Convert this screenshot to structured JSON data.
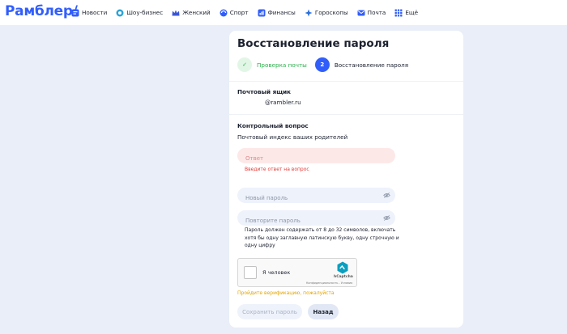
{
  "header": {
    "logo": "Рамблер/",
    "nav": [
      {
        "label": "Новости",
        "icon": "news-icon",
        "color": "#315efb"
      },
      {
        "label": "Шоу-бизнес",
        "icon": "showbiz-icon",
        "color": "#2aa3d8"
      },
      {
        "label": "Женский",
        "icon": "crown-icon",
        "color": "#3a55d9"
      },
      {
        "label": "Спорт",
        "icon": "sport-icon",
        "color": "#315efb"
      },
      {
        "label": "Финансы",
        "icon": "finance-icon",
        "color": "#315efb"
      },
      {
        "label": "Гороскопы",
        "icon": "horoscope-icon",
        "color": "#2a6fe0"
      },
      {
        "label": "Почта",
        "icon": "mail-icon",
        "color": "#315efb"
      },
      {
        "label": "Ещё",
        "icon": "grid-icon",
        "color": "#315efb"
      }
    ]
  },
  "form": {
    "title": "Восстановление пароля",
    "steps": [
      {
        "label": "Проверка почты",
        "state": "done",
        "marker": "✓"
      },
      {
        "label": "Восстановление пароля",
        "state": "current",
        "marker": "2"
      }
    ],
    "mailbox_label": "Почтовый ящик",
    "mailbox_value": "@rambler.ru",
    "question_label": "Контрольный вопрос",
    "question_text": "Почтовый индекс ваших родителей",
    "answer_placeholder": "Ответ",
    "answer_error": "Введите ответ на вопрос",
    "new_password_placeholder": "Новый пароль",
    "repeat_password_placeholder": "Повторите пароль",
    "password_hint": "Пароль должен содержать от 8 до 32 символов, включать хотя бы одну заглавную латинскую букву, одну строчную и одну цифру",
    "captcha": {
      "label": "Я человек",
      "brand": "hCaptcha",
      "links": "Конфиденциальность - Условия"
    },
    "verify_message": "Пройдите верификацию, пожалуйста",
    "save_button": "Сохранить пароль",
    "back_button": "Назад"
  },
  "colors": {
    "accent": "#315efb",
    "success": "#2cb04d",
    "error": "#e53935",
    "warning": "#e0a400",
    "page_bg": "#e9eef8"
  }
}
